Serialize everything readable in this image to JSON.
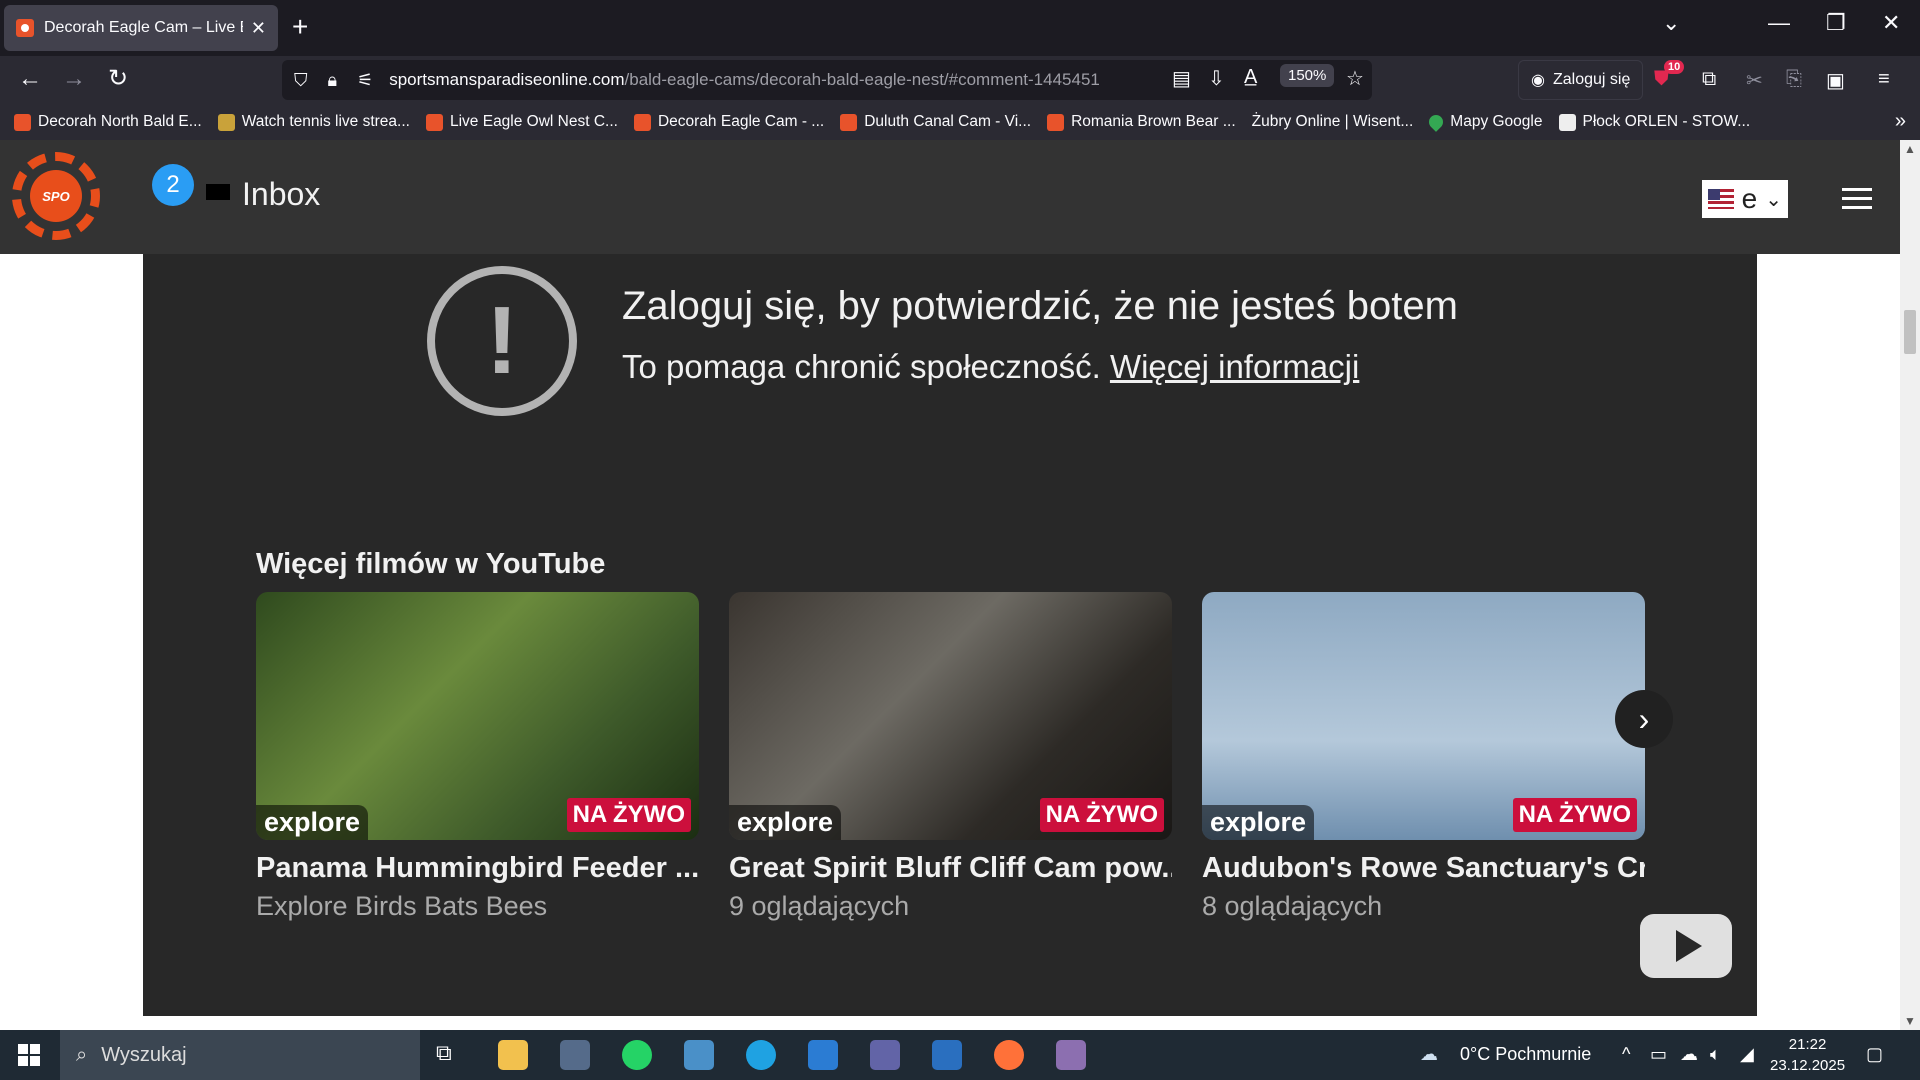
{
  "browser": {
    "tab_title": "Decorah Eagle Cam – Live Bald E",
    "tab_close": "✕",
    "new_tab": "+",
    "url_host": "sportsmansparadiseonline.com",
    "url_path": "/bald-eagle-cams/decorah-bald-eagle-nest/#comment-1445451",
    "zoom": "150%",
    "login_label": "Zaloguj się",
    "extension_badge": "10"
  },
  "bookmarks": [
    {
      "label": "Decorah North Bald E...",
      "icon": "spo"
    },
    {
      "label": "Watch tennis live strea...",
      "icon": "tennis"
    },
    {
      "label": "Live Eagle Owl Nest C...",
      "icon": "spo"
    },
    {
      "label": "Decorah Eagle Cam - ...",
      "icon": "spo"
    },
    {
      "label": "Duluth Canal Cam - Vi...",
      "icon": "spo"
    },
    {
      "label": "Romania Brown Bear ...",
      "icon": "spo"
    },
    {
      "label": "Żubry Online | Wisent...",
      "icon": "yt"
    },
    {
      "label": "Mapy Google",
      "icon": "maps"
    },
    {
      "label": "Płock ORLEN - STOW...",
      "icon": "orlen"
    }
  ],
  "site": {
    "logo_text": "SPO",
    "notification_count": "2",
    "inbox_label": "Inbox",
    "language_label": "e"
  },
  "youtube": {
    "warning_title": "Zaloguj się, by potwierdzić, że nie jesteś botem",
    "warning_sub": "To pomaga chronić społeczność.",
    "warning_link": "Więcej informacji",
    "more_videos_title": "Więcej filmów w YouTube",
    "cards": [
      {
        "title": "Panama Hummingbird Feeder ...",
        "subtitle": "Explore Birds Bats Bees",
        "explore": "explore",
        "live": "NA ŻYWO"
      },
      {
        "title": "Great Spirit Bluff Cliff Cam pow...",
        "subtitle": "9 oglądających",
        "explore": "explore",
        "live": "NA ŻYWO"
      },
      {
        "title": "Audubon's Rowe Sanctuary's Cr...",
        "subtitle": "8 oglądających",
        "explore": "explore",
        "live": "NA ŻYWO"
      }
    ]
  },
  "taskbar": {
    "search_placeholder": "Wyszukaj",
    "weather": "0°C Pochmurnie",
    "time": "21:22",
    "date": "23.12.2025"
  }
}
